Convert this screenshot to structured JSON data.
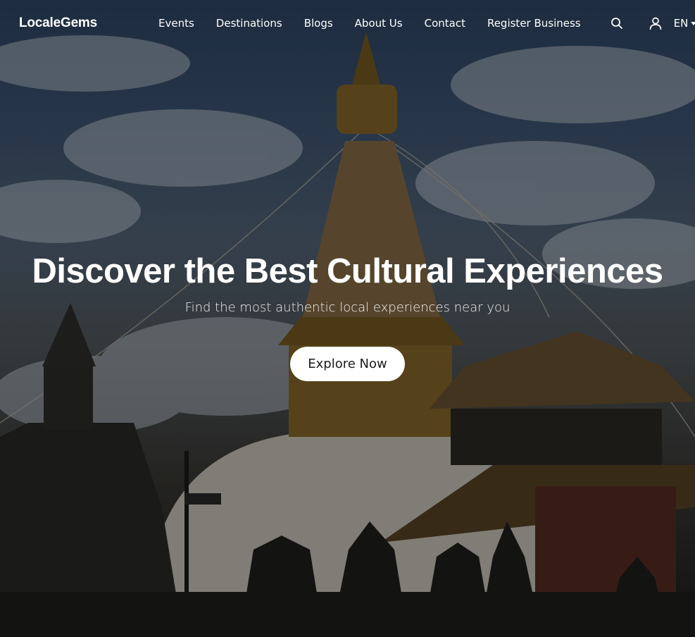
{
  "navbar": {
    "brand": "LocaleGems",
    "links": [
      "Events",
      "Destinations",
      "Blogs",
      "About Us",
      "Contact",
      "Register Business"
    ],
    "search_icon": "search-icon",
    "user_icon": "user-icon",
    "language": "EN"
  },
  "hero": {
    "title": "Discover the Best Cultural Experiences",
    "subtitle": "Find the most authentic local experiences near you",
    "cta_label": "Explore Now",
    "background_image": "stupa-temple-photo"
  },
  "colors": {
    "overlay": "#000000",
    "text": "#ffffff",
    "button_bg": "#ffffff",
    "button_text": "#1b1b1b"
  }
}
